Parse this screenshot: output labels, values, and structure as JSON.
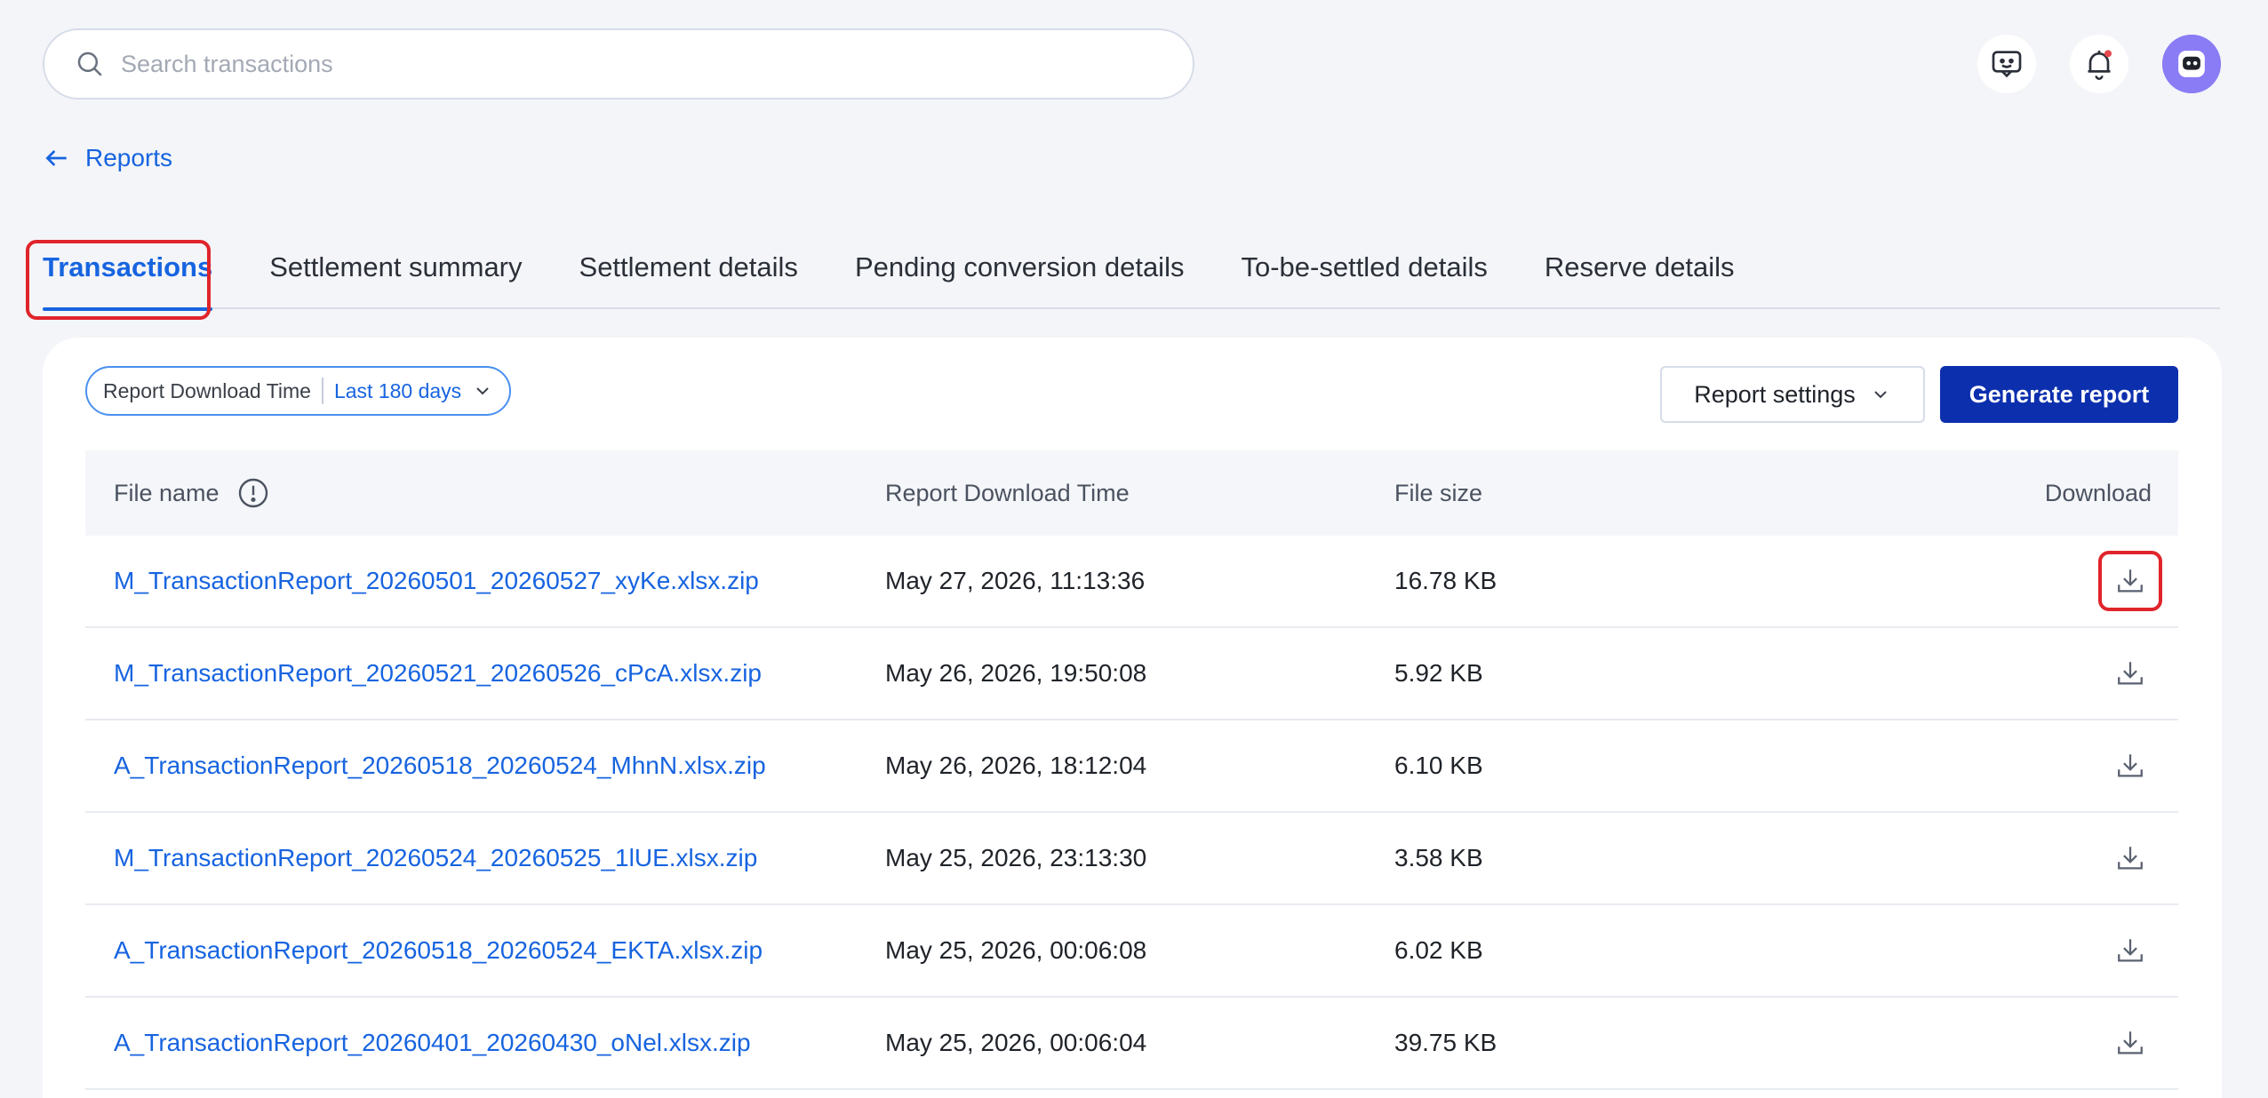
{
  "search": {
    "placeholder": "Search transactions"
  },
  "header_icons": [
    "feedback-icon",
    "bell-icon",
    "avatar"
  ],
  "breadcrumb": {
    "back_label": "Reports"
  },
  "tabs": [
    {
      "label": "Transactions",
      "active": true
    },
    {
      "label": "Settlement summary",
      "active": false
    },
    {
      "label": "Settlement details",
      "active": false
    },
    {
      "label": "Pending conversion details",
      "active": false
    },
    {
      "label": "To-be-settled details",
      "active": false
    },
    {
      "label": "Reserve details",
      "active": false
    }
  ],
  "filter": {
    "label": "Report Download Time",
    "value": "Last 180 days"
  },
  "actions": {
    "settings_label": "Report settings",
    "generate_label": "Generate report"
  },
  "table": {
    "headers": [
      "File name",
      "Report Download Time",
      "File size",
      "Download"
    ],
    "rows": [
      {
        "file": "M_TransactionReport_20260501_20260527_xyKe.xlsx.zip",
        "time": "May 27, 2026, 11:13:36",
        "size": "16.78 KB"
      },
      {
        "file": "M_TransactionReport_20260521_20260526_cPcA.xlsx.zip",
        "time": "May 26, 2026, 19:50:08",
        "size": "5.92 KB"
      },
      {
        "file": "A_TransactionReport_20260518_20260524_MhnN.xlsx.zip",
        "time": "May 26, 2026, 18:12:04",
        "size": "6.10 KB"
      },
      {
        "file": "M_TransactionReport_20260524_20260525_1lUE.xlsx.zip",
        "time": "May 25, 2026, 23:13:30",
        "size": "3.58 KB"
      },
      {
        "file": "A_TransactionReport_20260518_20260524_EKTA.xlsx.zip",
        "time": "May 25, 2026, 00:06:08",
        "size": "6.02 KB"
      },
      {
        "file": "A_TransactionReport_20260401_20260430_oNel.xlsx.zip",
        "time": "May 25, 2026, 00:06:04",
        "size": "39.75 KB"
      }
    ]
  },
  "colors": {
    "accent": "#1764e0",
    "primary_button": "#0c2fae",
    "highlight": "#e0242b"
  }
}
